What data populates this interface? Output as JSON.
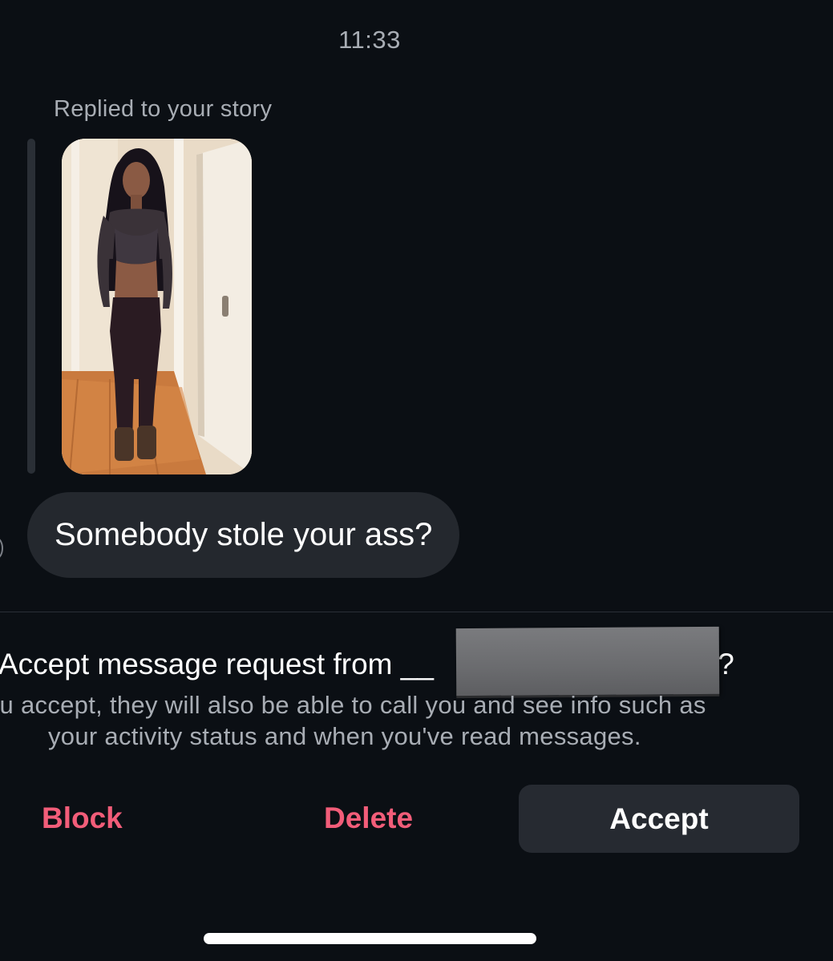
{
  "thread": {
    "timestamp": "11:33",
    "reply_label": "Replied to your story",
    "story_image": "story-photo",
    "message_text": "Somebody stole your ass?"
  },
  "request": {
    "title_prefix": "Accept message request from __",
    "title_suffix": ")?",
    "subtitle_line1": "ou accept, they will also be able to call you and see info such as",
    "subtitle_line2": "your activity status and when you've read messages."
  },
  "actions": {
    "block_label": "Block",
    "delete_label": "Delete",
    "accept_label": "Accept"
  },
  "colors": {
    "background": "#0b0f14",
    "bubble": "#24282e",
    "destructive": "#f25d79",
    "secondary_text": "#a8adb4"
  }
}
